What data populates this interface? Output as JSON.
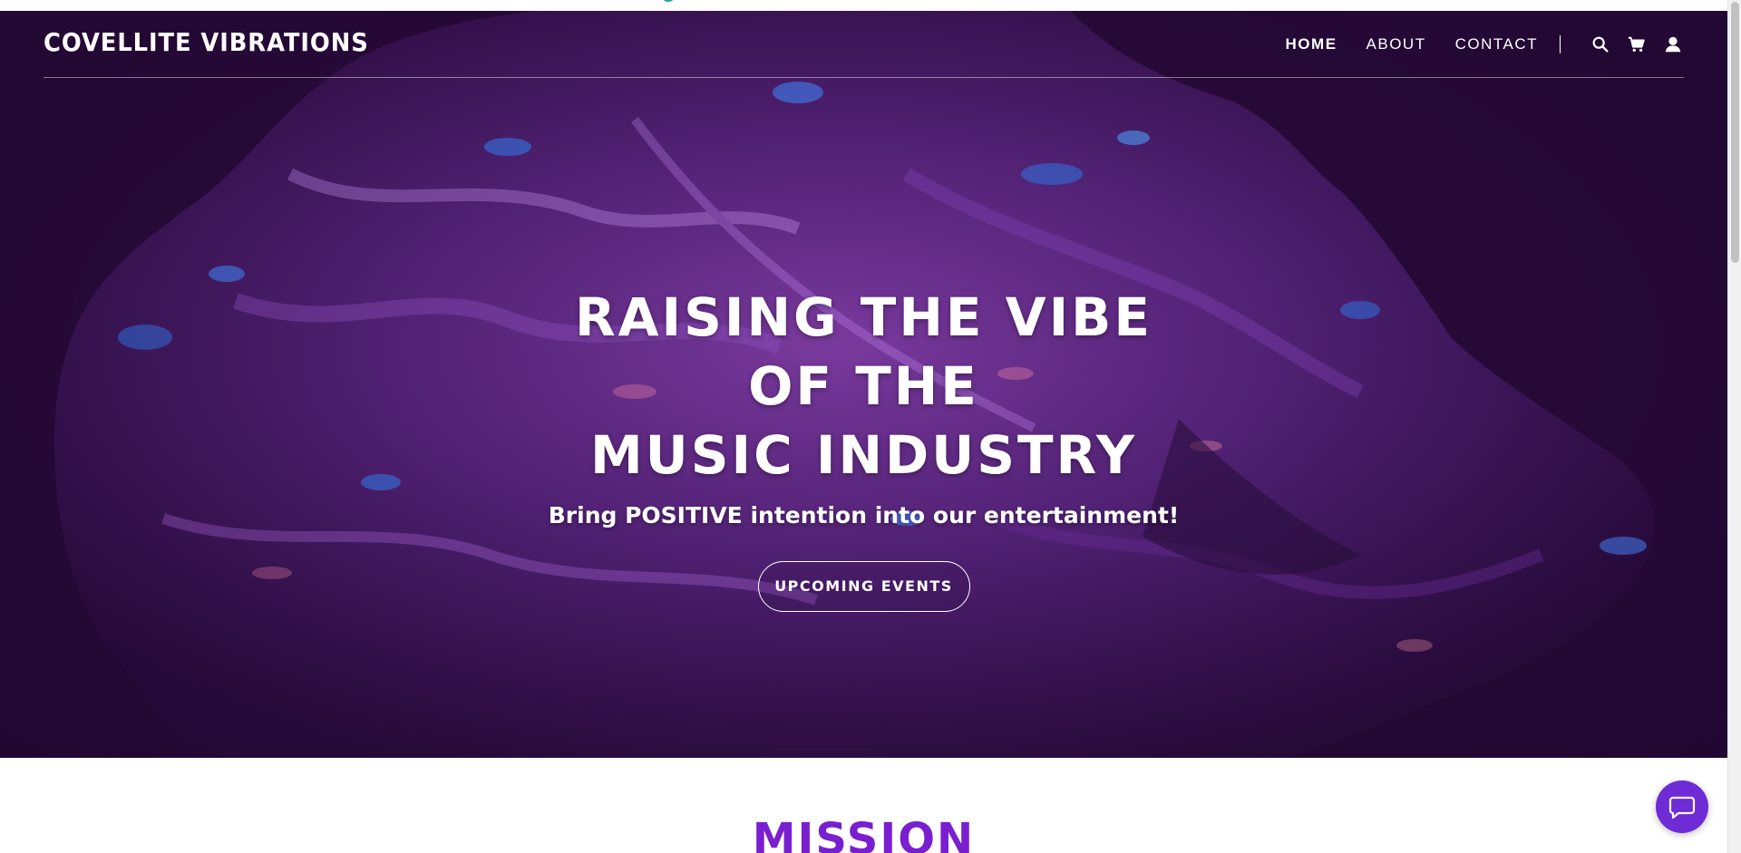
{
  "brand": "COVELLITE VIBRATIONS",
  "nav": {
    "items": [
      {
        "label": "HOME",
        "active": true
      },
      {
        "label": "ABOUT",
        "active": false
      },
      {
        "label": "CONTACT",
        "active": false
      }
    ],
    "icons": [
      "search-icon",
      "cart-icon",
      "account-icon"
    ]
  },
  "hero": {
    "title_line1": "RAISING THE VIBE OF THE",
    "title_line2": "MUSIC INDUSTRY",
    "subtitle": "Bring POSITIVE intention into our entertainment!",
    "button_label": "UPCOMING EVENTS"
  },
  "mission": {
    "title": "MISSION"
  },
  "chat": {
    "icon": "chat-icon"
  },
  "colors": {
    "hero_bg": "#2a0b3b",
    "accent": "#7a1fd0",
    "chat": "#6f2bd6",
    "loader": "#1fa7a3"
  }
}
